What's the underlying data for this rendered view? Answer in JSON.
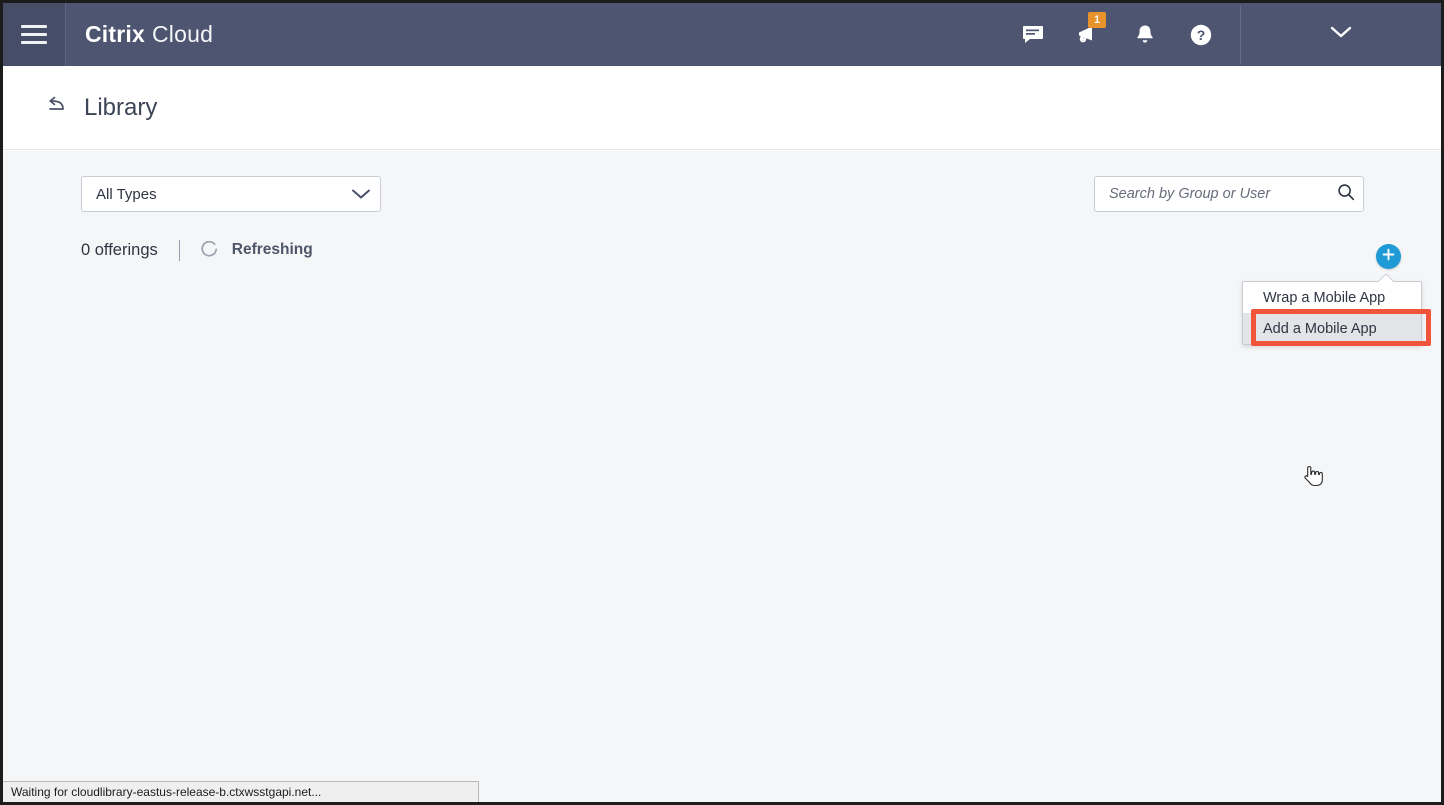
{
  "appbar": {
    "menu_icon": "hamburger-icon",
    "brand_bold": "Citrix",
    "brand_light": "Cloud",
    "icons": [
      {
        "name": "feedback-icon",
        "label": "Feedback"
      },
      {
        "name": "announcements-icon",
        "label": "Announcements",
        "badge": "1"
      },
      {
        "name": "notifications-bell-icon",
        "label": "Notifications"
      },
      {
        "name": "help-icon",
        "label": "Help"
      }
    ],
    "account_caret": "chevron-down-icon",
    "bar_color": "#4e5570",
    "badge_color": "#e8922c"
  },
  "titlebar": {
    "back_icon": "back-arrow-icon",
    "title": "Library"
  },
  "toolbar": {
    "type_filter_value": "All Types",
    "type_filter_caret": "chevron-down-icon",
    "search_placeholder": "Search by Group or User",
    "search_value": "",
    "search_icon": "search-icon"
  },
  "status": {
    "offerings_count": "0 offerings",
    "refresh_label": "Refreshing",
    "spinner_icon": "loading-spinner-icon"
  },
  "add_menu": {
    "trigger_icon": "plus-icon",
    "trigger_color": "#1f9ad6",
    "items": [
      {
        "label": "Wrap a Mobile App",
        "hovered": false
      },
      {
        "label": "Add a Mobile App",
        "hovered": true
      }
    ],
    "highlight_color": "#f0543a"
  },
  "statusbar": {
    "text": "Waiting for cloudlibrary-eastus-release-b.ctxwsstgapi.net..."
  }
}
